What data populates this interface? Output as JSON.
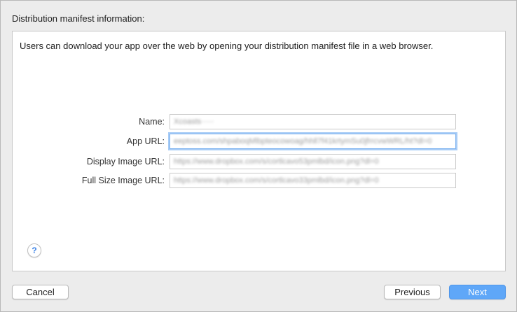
{
  "section_title": "Distribution manifest information:",
  "description": "Users can download your app over the web by opening your distribution manifest file in a web browser.",
  "fields": [
    {
      "label": "Name:",
      "value": "Xcoasts·····"
    },
    {
      "label": "App URL:",
      "value": "eeptoss.com/shpaboqMlbpteocowoag/hhll7f41krtymSu0jfrrcvwWRL/ht?dl=0"
    },
    {
      "label": "Display Image URL:",
      "value": "https://www.dropbox.com/s/cortlcavo53pmlbd/icon.png?dl=0"
    },
    {
      "label": "Full Size Image URL:",
      "value": "https://www.dropbox.com/s/cortlcavo33pmlbd/icon.png?dl=0"
    }
  ],
  "help_label": "?",
  "buttons": {
    "cancel": "Cancel",
    "previous": "Previous",
    "next": "Next"
  },
  "colors": {
    "accent": "#5fa7f8",
    "focus_ring": "#a8ccf6",
    "background": "#ececec"
  }
}
